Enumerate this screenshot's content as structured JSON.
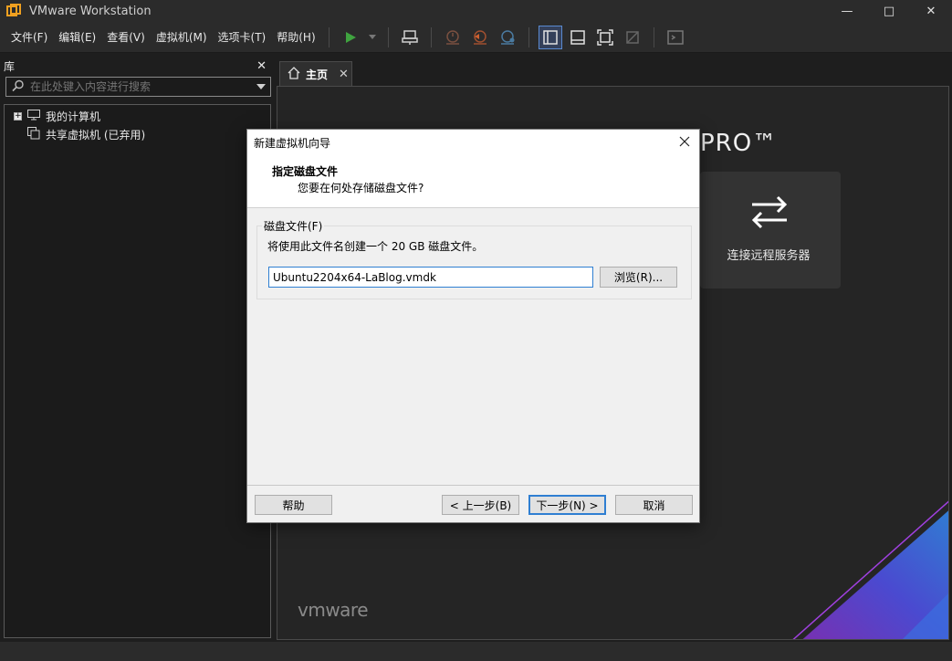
{
  "window": {
    "title": "VMware Workstation",
    "controls": {
      "minimize": "—",
      "maximize": "□",
      "close": "✕"
    }
  },
  "menu": {
    "items": [
      "文件(F)",
      "编辑(E)",
      "查看(V)",
      "虚拟机(M)",
      "选项卡(T)",
      "帮助(H)"
    ]
  },
  "toolbar": {
    "icons": [
      "play-icon",
      "dropdown-icon",
      "send-ctrl-alt-del-icon",
      "snapshot-icon",
      "revert-snapshot-icon",
      "snapshot-manager-icon",
      "library-view-icon",
      "thumbnail-view-icon",
      "fullscreen-icon",
      "unity-icon",
      "console-icon"
    ]
  },
  "library": {
    "title": "库",
    "close": "✕",
    "search_placeholder": "在此处键入内容进行搜索",
    "tree": [
      {
        "label": "我的计算机",
        "expander": "+"
      },
      {
        "label": "共享虚拟机 (已弃用)"
      }
    ]
  },
  "tabs": {
    "home_label": "主页",
    "close": "✕"
  },
  "home": {
    "pro_logo": "PRO™",
    "remote_label": "连接远程服务器",
    "brand": "vmware"
  },
  "dialog": {
    "title": "新建虚拟机向导",
    "header_title": "指定磁盘文件",
    "header_subtitle": "您要在何处存储磁盘文件?",
    "group_label": "磁盘文件(F)",
    "description": "将使用此文件名创建一个 20 GB 磁盘文件。",
    "file_value": "Ubuntu2204x64-LaBlog.vmdk",
    "browse_label": "浏览(R)...",
    "help_label": "帮助",
    "back_label": "< 上一步(B)",
    "next_label": "下一步(N) >",
    "cancel_label": "取消"
  },
  "colors": {
    "accent": "#2f7fd2",
    "play_green": "#3fa33f",
    "dark_bg": "#1e1e1e"
  }
}
